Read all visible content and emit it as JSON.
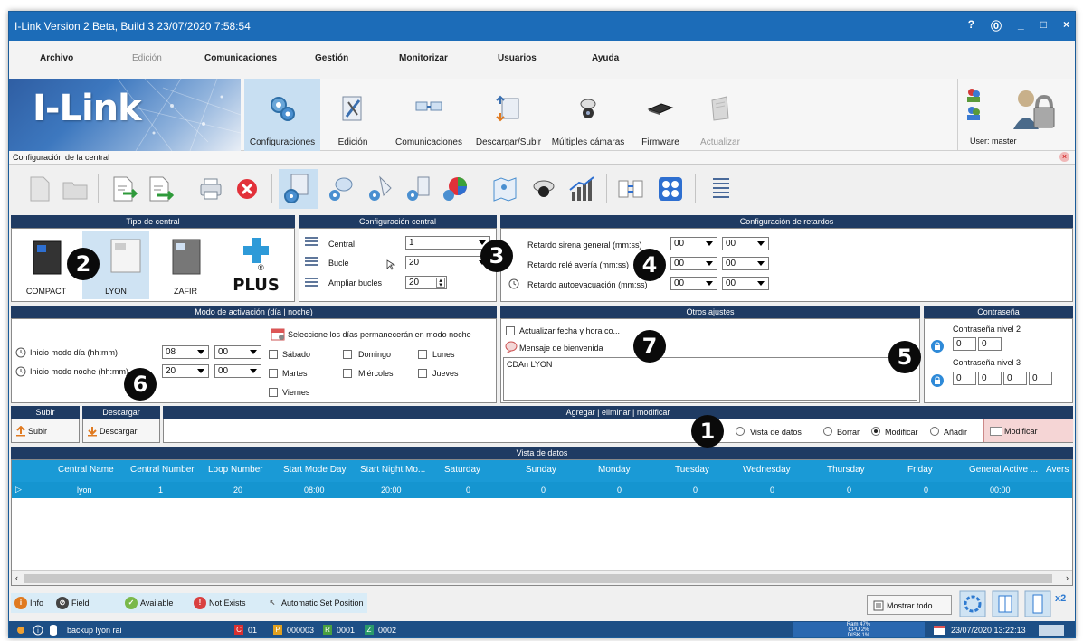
{
  "window": {
    "title": "I-Link Version 2 Beta, Build 3 23/07/2020 7:58:54",
    "controls": [
      "?",
      "⓪",
      "_",
      "□",
      "×"
    ]
  },
  "menu": [
    "Archivo",
    "Edición",
    "Comunicaciones",
    "Gestión",
    "Monitorizar",
    "Usuarios",
    "Ayuda"
  ],
  "ribbon": {
    "brand": "I-Link",
    "items": [
      "Configuraciones",
      "Edición",
      "Comunicaciones",
      "Descargar/Subir",
      "Múltiples cámaras",
      "Firmware",
      "Actualizar"
    ],
    "user": "User: master"
  },
  "subbar": {
    "title": "Configuración de la central"
  },
  "tipo": {
    "header": "Tipo de central",
    "items": [
      "COMPACT",
      "LYON",
      "ZAFIR",
      "PLUS"
    ],
    "plus_mark": "®"
  },
  "config": {
    "header": "Configuración central",
    "central_label": "Central",
    "central_value": "1",
    "bucle_label": "Bucle",
    "bucle_value": "20",
    "ampliar_label": "Ampliar bucles",
    "ampliar_value": "20"
  },
  "retardos": {
    "header": "Configuración de retardos",
    "rows": [
      {
        "label": "Retardo sirena general (mm:ss)",
        "mm": "00",
        "ss": "00"
      },
      {
        "label": "Retardo relé avería (mm:ss)",
        "mm": "00",
        "ss": "00"
      },
      {
        "label": "Retardo autoevacuación (mm:ss)",
        "mm": "00",
        "ss": "00"
      }
    ]
  },
  "modo": {
    "header": "Modo de activación (día | noche)",
    "dia_label": "Inicio modo día (hh:mm)",
    "dia_h": "08",
    "dia_m": "00",
    "noche_label": "Inicio modo noche (hh:mm)",
    "noche_h": "20",
    "noche_m": "00",
    "days_title": "Seleccione los días permanecerán en modo noche",
    "days": [
      "Sábado",
      "Domingo",
      "Lunes",
      "Martes",
      "Miércoles",
      "Jueves",
      "Viernes"
    ]
  },
  "otros": {
    "header": "Otros ajustes",
    "actualizar_label": "Actualizar fecha y hora co...",
    "mensaje_label": "Mensaje de bienvenida",
    "mensaje_value": "CDAn LYON"
  },
  "contrasena": {
    "header": "Contraseña",
    "nivel2_label": "Contraseña nivel 2",
    "nivel3_label": "Contraseña nivel 3",
    "digit": "0"
  },
  "badges": [
    "1",
    "2",
    "3",
    "4",
    "5",
    "6",
    "7"
  ],
  "actions": {
    "subir_header": "Subir",
    "subir_label": "Subir",
    "descargar_header": "Descargar",
    "descargar_label": "Descargar",
    "agregar_header": "Agregar | eliminar | modificar",
    "radios": [
      "Vista de datos",
      "Borrar",
      "Modificar",
      "Añadir"
    ],
    "modificar_button": "Modificar"
  },
  "vista": {
    "header": "Vista de datos",
    "columns": [
      "Central Name",
      "Central Number",
      "Loop Number",
      "Start Mode Day",
      "Start Night Mo...",
      "Saturday",
      "Sunday",
      "Monday",
      "Tuesday",
      "Wednesday",
      "Thursday",
      "Friday",
      "General Active ...",
      "Avers"
    ],
    "row": [
      "lyon",
      "1",
      "20",
      "08:00",
      "20:00",
      "0",
      "0",
      "0",
      "0",
      "0",
      "0",
      "0",
      "00:00",
      ""
    ]
  },
  "legend": [
    "Info",
    "Field",
    "Available",
    "Not Exists",
    "Automatic Set Position"
  ],
  "mostrar_todo": "Mostrar todo",
  "x2": "x2",
  "status": {
    "backup": "backup lyon rai",
    "c_code": "C",
    "c_val": "01",
    "p_code": "P",
    "p_val": "000003",
    "r_code": "R",
    "r_val": "0001",
    "z_code": "Z",
    "z_val": "0002",
    "ram": "Ram 47%",
    "cpu": "CPU 2%",
    "disk": "DISK 1%",
    "datetime": "23/07/2020 13:22:13"
  },
  "colors": {
    "title_bar": "#1c6cb8",
    "panel_header": "#1f3b63",
    "selected_row": "#1b9bd8",
    "status_bar": "#1d4f86"
  }
}
